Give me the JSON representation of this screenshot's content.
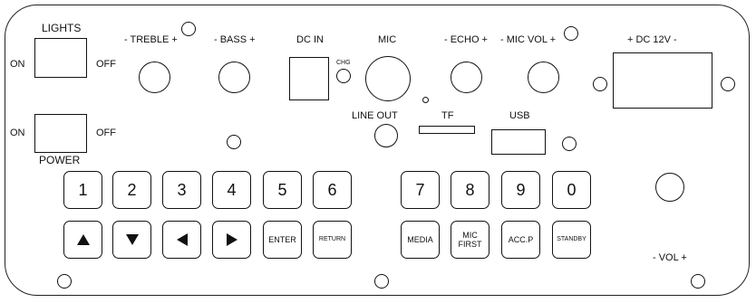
{
  "switches": {
    "lights": {
      "title": "LIGHTS",
      "on": "ON",
      "off": "OFF"
    },
    "power": {
      "title": "POWER",
      "on": "ON",
      "off": "OFF"
    }
  },
  "labels": {
    "treble": "- TREBLE +",
    "bass": "- BASS +",
    "dc_in": "DC IN",
    "chg": "CHG",
    "mic": "MIC",
    "echo": "- ECHO +",
    "mic_vol": "- MIC VOL +",
    "dc12v": "+ DC 12V -",
    "line_out": "LINE OUT",
    "tf": "TF",
    "usb": "USB",
    "vol": "- VOL +"
  },
  "keys": {
    "numbers": [
      "1",
      "2",
      "3",
      "4",
      "5",
      "6",
      "7",
      "8",
      "9",
      "0"
    ],
    "enter": "ENTER",
    "return": "RETURN",
    "media": "MEDIA",
    "mic_first_line1": "MIC",
    "mic_first_line2": "FIRST",
    "acc_p": "ACC.P",
    "standby": "STANDBY"
  }
}
